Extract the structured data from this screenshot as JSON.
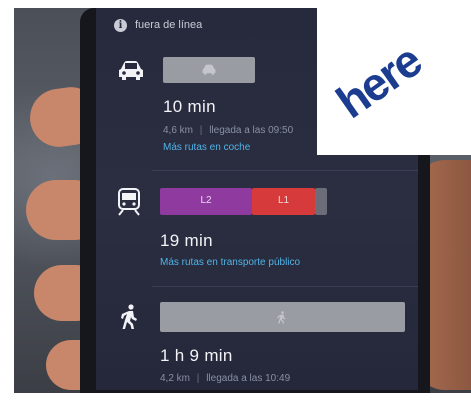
{
  "status_bar": {
    "info_icon_glyph": "i",
    "offline_text": "fuera de línea"
  },
  "routes": {
    "car": {
      "icon": "car-icon",
      "time": "10 min",
      "distance": "4,6 km",
      "arrival": "llegada a las 09:50",
      "link": "Más rutas en coche"
    },
    "transit": {
      "icon": "train-icon",
      "segments": [
        {
          "label": "L2",
          "color": "#8e3a9f"
        },
        {
          "label": "L1",
          "color": "#d63a3a"
        }
      ],
      "time": "19 min",
      "link": "Más rutas en transporte público"
    },
    "walk": {
      "icon": "walking-icon",
      "time": "1 h 9 min",
      "distance": "4,2 km",
      "arrival": "llegada a las 10:49"
    }
  },
  "meta_separator": "|",
  "logo": {
    "text": "here",
    "color": "#1b3c8f"
  },
  "colors": {
    "screen_bg": "#262a3c",
    "link": "#4fb3e8",
    "bar_gray": "#9a9ca4"
  }
}
